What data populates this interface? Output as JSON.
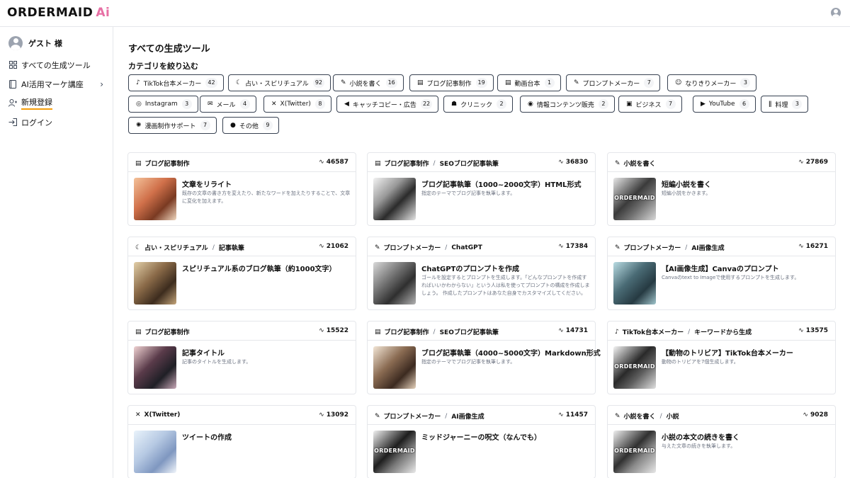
{
  "header": {
    "logo_text": "ORDERMAID",
    "logo_ai": "Ai",
    "user_icon": "user-circle-icon"
  },
  "sidebar": {
    "guest_name": "ゲスト 様",
    "items": [
      {
        "label": "すべての生成ツール",
        "icon": "grid-icon"
      },
      {
        "label": "AI活用マーケ講座",
        "icon": "book-icon"
      },
      {
        "label": "新規登録",
        "icon": "user-plus-icon"
      },
      {
        "label": "ログイン",
        "icon": "login-icon"
      }
    ]
  },
  "main": {
    "title": "すべての生成ツール",
    "category_title": "カテゴリを絞り込む",
    "chips": [
      {
        "label": "TikTok台本メーカー",
        "count": "42",
        "icon": "♪"
      },
      {
        "label": "占い・スピリチュアル",
        "count": "92",
        "icon": "☾"
      },
      {
        "label": "小説を書く",
        "count": "16",
        "icon": "✎"
      },
      {
        "label": "ブログ記事制作",
        "count": "19",
        "icon": "▤"
      },
      {
        "label": "動画台本",
        "count": "1",
        "icon": "▤"
      },
      {
        "label": "プロンプトメーカー",
        "count": "7",
        "icon": "✎"
      },
      {
        "label": "なりきりメーカー",
        "count": "3",
        "icon": "☺"
      },
      {
        "label": "Instagram",
        "count": "3",
        "icon": "◎"
      },
      {
        "label": "メール",
        "count": "4",
        "icon": "✉"
      },
      {
        "label": "X(Twitter)",
        "count": "8",
        "icon": "✕"
      },
      {
        "label": "キャッチコピー・広告",
        "count": "22",
        "icon": "◀"
      },
      {
        "label": "クリニック",
        "count": "2",
        "icon": "☗"
      },
      {
        "label": "情報コンテンツ販売",
        "count": "2",
        "icon": "◉"
      },
      {
        "label": "ビジネス",
        "count": "7",
        "icon": "▣"
      },
      {
        "label": "YouTube",
        "count": "6",
        "icon": "▶"
      },
      {
        "label": "料理",
        "count": "3",
        "icon": "ǁ"
      },
      {
        "label": "漫画制作サポート",
        "count": "7",
        "icon": "✺"
      },
      {
        "label": "その他",
        "count": "9",
        "icon": "●"
      }
    ],
    "cards": [
      {
        "cat": "ブログ記事制作",
        "sub": "",
        "count": "46587",
        "title": "文章をリライト",
        "desc": "既存の文章の書き方を変えたり、新たなワードを加えたりすることで、文章に変化を加えます。",
        "icon": "▤",
        "thumb_text": ""
      },
      {
        "cat": "ブログ記事制作",
        "sub": "SEOブログ記事執筆",
        "count": "36830",
        "title": "ブログ記事執筆（1000~2000文字）HTML形式",
        "desc": "指定のテーマでブログ記事を執筆します。",
        "icon": "▤",
        "thumb_text": ""
      },
      {
        "cat": "小説を書く",
        "sub": "",
        "count": "27869",
        "title": "短編小説を書く",
        "desc": "短編小説をかきます。",
        "icon": "✎",
        "thumb_text": "ORDERMAID"
      },
      {
        "cat": "占い・スピリチュアル",
        "sub": "記事執筆",
        "count": "21062",
        "title": "スピリチュアル系のブログ執筆（約1000文字）",
        "desc": "",
        "icon": "☾",
        "thumb_text": ""
      },
      {
        "cat": "プロンプトメーカー",
        "sub": "ChatGPT",
        "count": "17384",
        "title": "ChatGPTのプロンプトを作成",
        "desc": "ゴールを設定するとプロンプトを生成します。「どんなプロンプトを作成すればいいかわからない」という人は私を使ってプロンプトの構成を作成しましょう。 作成したプロンプトはあなた自身でカスタマイズしてください。",
        "icon": "✎",
        "thumb_text": ""
      },
      {
        "cat": "プロンプトメーカー",
        "sub": "AI画像生成",
        "count": "16271",
        "title": "【AI画像生成】Canvaのプロンプト",
        "desc": "Canvaのtext to Imageで使用するプロンプトを生成します。",
        "icon": "✎",
        "thumb_text": ""
      },
      {
        "cat": "ブログ記事制作",
        "sub": "",
        "count": "15522",
        "title": "記事タイトル",
        "desc": "記事のタイトルを生成します。",
        "icon": "▤",
        "thumb_text": ""
      },
      {
        "cat": "ブログ記事制作",
        "sub": "SEOブログ記事執筆",
        "count": "14731",
        "title": "ブログ記事執筆（4000~5000文字）Markdown形式",
        "desc": "指定のテーマでブログ記事を執筆します。",
        "icon": "▤",
        "thumb_text": ""
      },
      {
        "cat": "TikTok台本メーカー",
        "sub": "キーワードから生成",
        "count": "13575",
        "title": "【動物のトリビア】TikTok台本メーカー",
        "desc": "動物のトリビアを7個生成します。",
        "icon": "♪",
        "thumb_text": "ORDERMAID"
      },
      {
        "cat": "X(Twitter)",
        "sub": "",
        "count": "13092",
        "title": "ツイートの作成",
        "desc": "",
        "icon": "✕",
        "thumb_text": ""
      },
      {
        "cat": "プロンプトメーカー",
        "sub": "AI画像生成",
        "count": "11457",
        "title": "ミッドジャーニーの呪文（なんでも）",
        "desc": "",
        "icon": "✎",
        "thumb_text": "ORDERMAID"
      },
      {
        "cat": "小説を書く",
        "sub": "小説",
        "count": "9028",
        "title": "小説の本文の続きを書く",
        "desc": "与えた文章の続きを執筆します。",
        "icon": "✎",
        "thumb_text": "ORDERMAID"
      }
    ]
  }
}
